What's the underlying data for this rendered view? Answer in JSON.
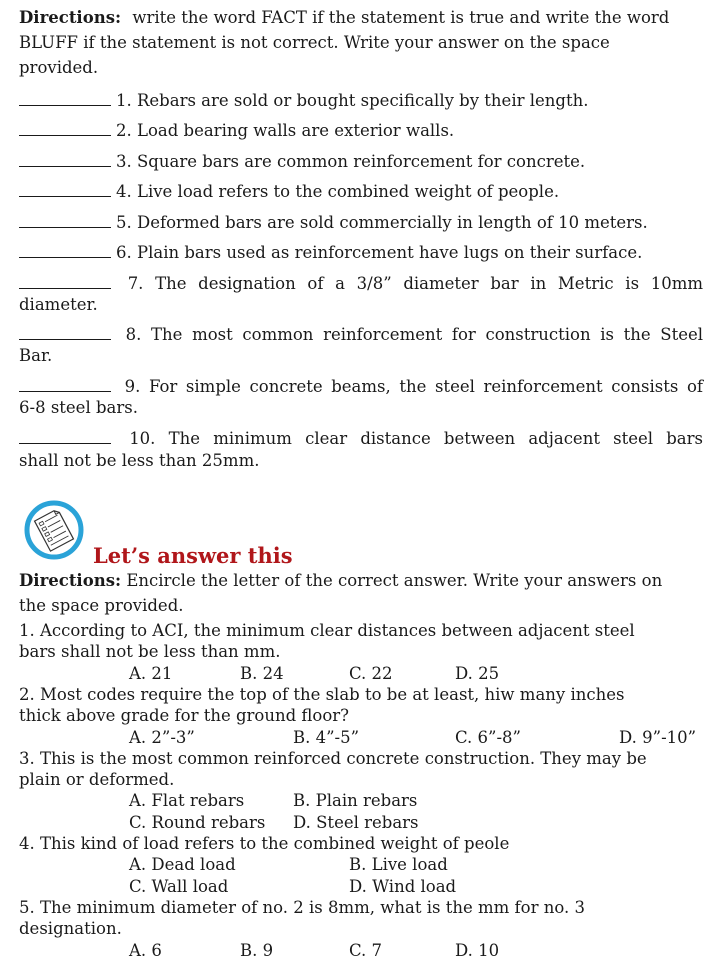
{
  "part1": {
    "directions_label": "Directions:",
    "directions_text_1": "write the word FACT if the statement is true and write the word",
    "directions_text_2": "BLUFF if the statement is not correct.  Write your answer on the space",
    "directions_text_3": "provided.",
    "items": [
      {
        "text": "1. Rebars are sold or bought specifically by their length."
      },
      {
        "text": "2. Load bearing walls are exterior walls."
      },
      {
        "text": "3. Square bars are common reinforcement for concrete."
      },
      {
        "text": "4. Live load refers to the combined weight of people."
      },
      {
        "text": "5. Deformed bars are sold commercially in length of 10 meters."
      },
      {
        "text": "6. Plain bars used as reinforcement have lugs on their surface."
      },
      {
        "text": "7. The designation of a 3/8” diameter bar in Metric is 10mm",
        "cont": "diameter."
      },
      {
        "text": "8. The most common reinforcement for construction is the Steel",
        "cont": "Bar."
      },
      {
        "text": "9. For simple concrete beams, the steel reinforcement consists of",
        "cont": "6-8 steel bars."
      },
      {
        "text": "10. The minimum clear distance between adjacent steel bars",
        "cont": "shall not be less than 25mm."
      }
    ]
  },
  "section2": {
    "icon": "worksheet-icon",
    "heading": "Let’s answer this",
    "heading_color": "#b0161a",
    "icon_ring_color": "#2aa3d8",
    "directions_label": "Directions:",
    "directions_text_1": "Encircle the letter of the correct answer.  Write your answers on",
    "directions_text_2": "the space provided.",
    "questions": [
      {
        "lines": [
          "1. According to ACI, the minimum clear distances between adjacent steel",
          "bars shall not be less than mm."
        ],
        "options": [
          "A. 21",
          "B. 24",
          "C. 22",
          "D. 25"
        ]
      },
      {
        "lines": [
          "2. Most codes require the top of the slab to be at least, hiw many inches",
          "thick above grade for the ground floor?"
        ],
        "options": [
          "A. 2”-3”",
          "B. 4”-5”",
          "C. 6”-8”",
          "D. 9”-10”"
        ]
      },
      {
        "lines": [
          "3. This is the most common reinforced concrete construction. They may be",
          "plain or deformed."
        ],
        "options": [
          "A. Flat rebars",
          "B. Plain rebars",
          "C. Round rebars",
          "D. Steel rebars"
        ]
      },
      {
        "lines": [
          "4. This kind of load refers to the combined weight of peole"
        ],
        "options": [
          "A. Dead load",
          "B. Live load",
          "C. Wall load",
          "D. Wind load"
        ]
      },
      {
        "lines": [
          "5. The minimum diameter of no. 2 is 8mm, what is the mm for no. 3",
          "designation."
        ],
        "options": [
          "A. 6",
          "B. 9",
          "C. 7",
          "D. 10"
        ]
      }
    ]
  }
}
